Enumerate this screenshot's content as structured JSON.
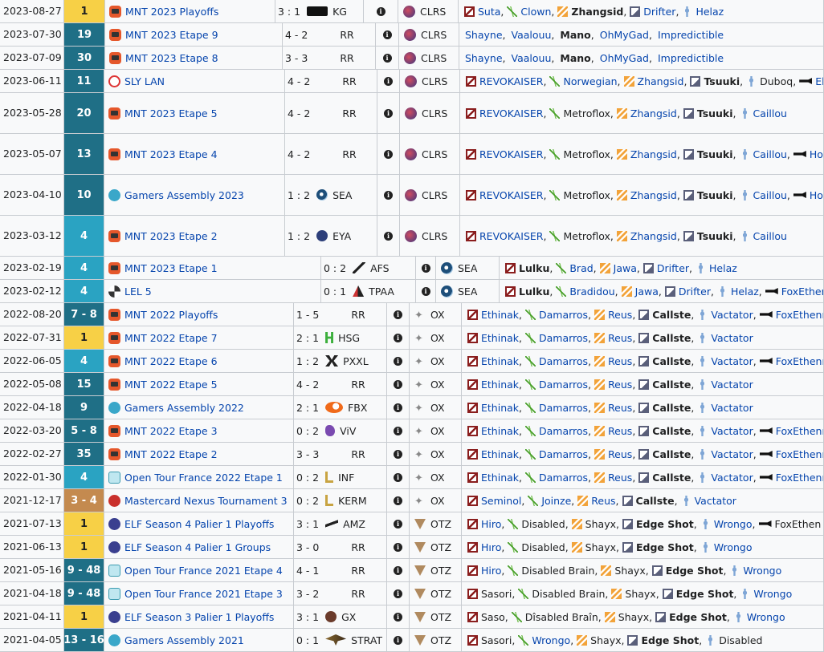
{
  "rows": [
    {
      "date": "2023-08-27",
      "place": "1",
      "pc": "#f7d046",
      "pt": "#202122",
      "tlogo": "mnt",
      "tour": "MNT 2023 Playoffs",
      "score": "3 : 1",
      "opp": "KG",
      "ologo": "kg",
      "team": "CLRS",
      "tcls": "clrs",
      "roster": [
        {
          "n": "Suta",
          "r": "top"
        },
        {
          "n": "Clown",
          "r": "jungle"
        },
        {
          "n": "Zhangsid",
          "r": "mid",
          "b": true,
          "k": true
        },
        {
          "n": "Drifter",
          "r": "bot"
        },
        {
          "n": "Helaz",
          "r": "support"
        }
      ]
    },
    {
      "date": "2023-07-30",
      "place": "19",
      "pc": "#1f6f86",
      "pt": "#fff",
      "tlogo": "mnt",
      "tour": "MNT 2023 Etape 9",
      "score": "4 - 2",
      "opp": "RR",
      "ologo": "",
      "team": "CLRS",
      "tcls": "clrs",
      "plain": true,
      "roster": [
        {
          "n": "Shayne"
        },
        {
          "n": "Vaalouu"
        },
        {
          "n": "Mano",
          "b": true,
          "k": true
        },
        {
          "n": "OhMyGad"
        },
        {
          "n": "Impredictible"
        }
      ]
    },
    {
      "date": "2023-07-09",
      "place": "30",
      "pc": "#1f6f86",
      "pt": "#fff",
      "tlogo": "mnt",
      "tour": "MNT 2023 Etape 8",
      "score": "3 - 3",
      "opp": "RR",
      "ologo": "",
      "team": "CLRS",
      "tcls": "clrs",
      "plain": true,
      "roster": [
        {
          "n": "Shayne"
        },
        {
          "n": "Vaalouu"
        },
        {
          "n": "Mano",
          "b": true,
          "k": true
        },
        {
          "n": "OhMyGad"
        },
        {
          "n": "Impredictible"
        }
      ]
    },
    {
      "date": "2023-06-11",
      "place": "11",
      "pc": "#1f6f86",
      "pt": "#fff",
      "tlogo": "sly",
      "tour": "SLY LAN",
      "score": "4 - 2",
      "opp": "RR",
      "ologo": "",
      "team": "CLRS",
      "tcls": "clrs",
      "roster": [
        {
          "n": "REVOKAISER",
          "r": "top"
        },
        {
          "n": "Norwegian",
          "r": "jungle"
        },
        {
          "n": "Zhangsid",
          "r": "mid"
        },
        {
          "n": "Tsuuki",
          "r": "bot",
          "b": true,
          "k": true
        },
        {
          "n": "Duboq",
          "r": "support",
          "k": true
        },
        {
          "n": "Ekaos",
          "r": "coach"
        }
      ]
    },
    {
      "date": "2023-05-28",
      "place": "20",
      "pc": "#1f6f86",
      "pt": "#fff",
      "tlogo": "mnt",
      "tour": "MNT 2023 Etape 5",
      "score": "4 - 2",
      "opp": "RR",
      "ologo": "",
      "team": "CLRS",
      "tcls": "clrs",
      "roster": [
        {
          "n": "REVOKAISER",
          "r": "top"
        },
        {
          "n": "Metroflox",
          "r": "jungle",
          "k": true
        },
        {
          "n": "Zhangsid",
          "r": "mid"
        },
        {
          "n": "Tsuuki",
          "r": "bot",
          "b": true,
          "k": true
        },
        {
          "n": "Caillou",
          "r": "support"
        }
      ]
    },
    {
      "date": "2023-05-07",
      "place": "13",
      "pc": "#1f6f86",
      "pt": "#fff",
      "tlogo": "mnt",
      "tour": "MNT 2023 Etape 4",
      "score": "4 - 2",
      "opp": "RR",
      "ologo": "",
      "team": "CLRS",
      "tcls": "clrs",
      "roster": [
        {
          "n": "REVOKAISER",
          "r": "top"
        },
        {
          "n": "Metroflox",
          "r": "jungle",
          "k": true
        },
        {
          "n": "Zhangsid",
          "r": "mid"
        },
        {
          "n": "Tsuuki",
          "r": "bot",
          "b": true,
          "k": true
        },
        {
          "n": "Caillou",
          "r": "support"
        },
        {
          "n": "Horéüs",
          "r": "coach"
        }
      ]
    },
    {
      "date": "2023-04-10",
      "place": "10",
      "pc": "#1f6f86",
      "pt": "#fff",
      "tlogo": "ga",
      "tour": "Gamers Assembly 2023",
      "score": "1 : 2",
      "opp": "SEA",
      "ologo": "sea",
      "team": "CLRS",
      "tcls": "clrs",
      "roster": [
        {
          "n": "REVOKAISER",
          "r": "top"
        },
        {
          "n": "Metroflox",
          "r": "jungle",
          "k": true
        },
        {
          "n": "Zhangsid",
          "r": "mid"
        },
        {
          "n": "Tsuuki",
          "r": "bot",
          "b": true,
          "k": true
        },
        {
          "n": "Caillou",
          "r": "support"
        },
        {
          "n": "Horéüs",
          "r": "coach"
        }
      ]
    },
    {
      "date": "2023-03-12",
      "place": "4",
      "pc": "#2aa3c2",
      "pt": "#fff",
      "tlogo": "mnt",
      "tour": "MNT 2023 Etape 2",
      "score": "1 : 2",
      "opp": "EYA",
      "ologo": "eya",
      "team": "CLRS",
      "tcls": "clrs",
      "roster": [
        {
          "n": "REVOKAISER",
          "r": "top"
        },
        {
          "n": "Metroflox",
          "r": "jungle",
          "k": true
        },
        {
          "n": "Zhangsid",
          "r": "mid"
        },
        {
          "n": "Tsuuki",
          "r": "bot",
          "b": true,
          "k": true
        },
        {
          "n": "Caillou",
          "r": "support"
        }
      ]
    },
    {
      "date": "2023-02-19",
      "place": "4",
      "pc": "#2aa3c2",
      "pt": "#fff",
      "tlogo": "mnt",
      "tour": "MNT 2023 Etape 1",
      "score": "0 : 2",
      "opp": "AFS",
      "ologo": "afs",
      "team": "SEA",
      "tcls": "sea",
      "roster": [
        {
          "n": "Lulku",
          "r": "top",
          "b": true,
          "k": true
        },
        {
          "n": "Brad",
          "r": "jungle"
        },
        {
          "n": "Jawa",
          "r": "mid"
        },
        {
          "n": "Drifter",
          "r": "bot"
        },
        {
          "n": "Helaz",
          "r": "support"
        }
      ]
    },
    {
      "date": "2023-02-12",
      "place": "4",
      "pc": "#2aa3c2",
      "pt": "#fff",
      "tlogo": "lel",
      "tour": "LEL 5",
      "score": "0 : 1",
      "opp": "TPAA",
      "ologo": "tpaa",
      "team": "SEA",
      "tcls": "sea",
      "roster": [
        {
          "n": "Lulku",
          "r": "top",
          "b": true,
          "k": true
        },
        {
          "n": "Bradidou",
          "r": "jungle"
        },
        {
          "n": "Jawa",
          "r": "mid"
        },
        {
          "n": "Drifter",
          "r": "bot"
        },
        {
          "n": "Helaz",
          "r": "support"
        },
        {
          "n": "FoxEthenn",
          "r": "coach"
        }
      ]
    },
    {
      "date": "2022-08-20",
      "place": "7 - 8",
      "pc": "#1f6f86",
      "pt": "#fff",
      "tlogo": "mnt",
      "tour": "MNT 2022 Playoffs",
      "score": "1 - 5",
      "opp": "RR",
      "ologo": "",
      "team": "OX",
      "tcls": "ox",
      "roster": [
        {
          "n": "Ethinak",
          "r": "top"
        },
        {
          "n": "Damarros",
          "r": "jungle"
        },
        {
          "n": "Reus",
          "r": "mid"
        },
        {
          "n": "Callste",
          "r": "bot",
          "b": true,
          "k": true
        },
        {
          "n": "Vactator",
          "r": "support"
        },
        {
          "n": "FoxEthenn",
          "r": "coach"
        }
      ]
    },
    {
      "date": "2022-07-31",
      "place": "1",
      "pc": "#f7d046",
      "pt": "#202122",
      "tlogo": "mnt",
      "tour": "MNT 2022 Etape 7",
      "score": "2 : 1",
      "opp": "HSG",
      "ologo": "hsg",
      "team": "OX",
      "tcls": "ox",
      "roster": [
        {
          "n": "Ethinak",
          "r": "top"
        },
        {
          "n": "Damarros",
          "r": "jungle"
        },
        {
          "n": "Reus",
          "r": "mid"
        },
        {
          "n": "Callste",
          "r": "bot",
          "b": true,
          "k": true
        },
        {
          "n": "Vactator",
          "r": "support"
        }
      ]
    },
    {
      "date": "2022-06-05",
      "place": "4",
      "pc": "#2aa3c2",
      "pt": "#fff",
      "tlogo": "mnt",
      "tour": "MNT 2022 Etape 6",
      "score": "1 : 2",
      "opp": "PXXL",
      "ologo": "pxxl",
      "team": "OX",
      "tcls": "ox",
      "roster": [
        {
          "n": "Ethinak",
          "r": "top"
        },
        {
          "n": "Damarros",
          "r": "jungle"
        },
        {
          "n": "Reus",
          "r": "mid"
        },
        {
          "n": "Callste",
          "r": "bot",
          "b": true,
          "k": true
        },
        {
          "n": "Vactator",
          "r": "support"
        },
        {
          "n": "FoxEthenn",
          "r": "coach"
        }
      ]
    },
    {
      "date": "2022-05-08",
      "place": "15",
      "pc": "#1f6f86",
      "pt": "#fff",
      "tlogo": "mnt",
      "tour": "MNT 2022 Etape 5",
      "score": "4 - 2",
      "opp": "RR",
      "ologo": "",
      "team": "OX",
      "tcls": "ox",
      "roster": [
        {
          "n": "Ethinak",
          "r": "top"
        },
        {
          "n": "Damarros",
          "r": "jungle"
        },
        {
          "n": "Reus",
          "r": "mid"
        },
        {
          "n": "Callste",
          "r": "bot",
          "b": true,
          "k": true
        },
        {
          "n": "Vactator",
          "r": "support"
        }
      ]
    },
    {
      "date": "2022-04-18",
      "place": "9",
      "pc": "#1f6f86",
      "pt": "#fff",
      "tlogo": "ga",
      "tour": "Gamers Assembly 2022",
      "score": "2 : 1",
      "opp": "FBX",
      "ologo": "fbx",
      "team": "OX",
      "tcls": "ox",
      "roster": [
        {
          "n": "Ethinak",
          "r": "top"
        },
        {
          "n": "Damarros",
          "r": "jungle"
        },
        {
          "n": "Reus",
          "r": "mid"
        },
        {
          "n": "Callste",
          "r": "bot",
          "b": true,
          "k": true
        },
        {
          "n": "Vactator",
          "r": "support"
        }
      ]
    },
    {
      "date": "2022-03-20",
      "place": "5 - 8",
      "pc": "#1f6f86",
      "pt": "#fff",
      "tlogo": "mnt",
      "tour": "MNT 2022 Etape 3",
      "score": "0 : 2",
      "opp": "ViV",
      "ologo": "viv",
      "team": "OX",
      "tcls": "ox",
      "roster": [
        {
          "n": "Ethinak",
          "r": "top"
        },
        {
          "n": "Damarros",
          "r": "jungle"
        },
        {
          "n": "Reus",
          "r": "mid"
        },
        {
          "n": "Callste",
          "r": "bot",
          "b": true,
          "k": true
        },
        {
          "n": "Vactator",
          "r": "support"
        },
        {
          "n": "FoxEthenn",
          "r": "coach"
        }
      ]
    },
    {
      "date": "2022-02-27",
      "place": "35",
      "pc": "#1f6f86",
      "pt": "#fff",
      "tlogo": "mnt",
      "tour": "MNT 2022 Etape 2",
      "score": "3 - 3",
      "opp": "RR",
      "ologo": "",
      "team": "OX",
      "tcls": "ox",
      "roster": [
        {
          "n": "Ethinak",
          "r": "top"
        },
        {
          "n": "Damarros",
          "r": "jungle"
        },
        {
          "n": "Reus",
          "r": "mid"
        },
        {
          "n": "Callste",
          "r": "bot",
          "b": true,
          "k": true
        },
        {
          "n": "Vactator",
          "r": "support"
        },
        {
          "n": "FoxEthenn",
          "r": "coach"
        }
      ]
    },
    {
      "date": "2022-01-30",
      "place": "4",
      "pc": "#2aa3c2",
      "pt": "#fff",
      "tlogo": "otf",
      "tour": "Open Tour France 2022 Etape 1",
      "score": "0 : 2",
      "opp": "INF",
      "ologo": "inf",
      "team": "OX",
      "tcls": "ox",
      "roster": [
        {
          "n": "Ethinak",
          "r": "top"
        },
        {
          "n": "Damarros",
          "r": "jungle"
        },
        {
          "n": "Reus",
          "r": "mid"
        },
        {
          "n": "Callste",
          "r": "bot",
          "b": true,
          "k": true
        },
        {
          "n": "Vactator",
          "r": "support"
        },
        {
          "n": "FoxEthenn",
          "r": "coach"
        }
      ]
    },
    {
      "date": "2021-12-17",
      "place": "3 - 4",
      "pc": "#c48a4f",
      "pt": "#fff",
      "tlogo": "mc",
      "tour": "Mastercard Nexus Tournament 3",
      "score": "0 : 2",
      "opp": "KERM",
      "ologo": "inf",
      "team": "OX",
      "tcls": "ox",
      "roster": [
        {
          "n": "Seminol",
          "r": "top"
        },
        {
          "n": "Joinze",
          "r": "jungle"
        },
        {
          "n": "Reus",
          "r": "mid"
        },
        {
          "n": "Callste",
          "r": "bot",
          "b": true,
          "k": true
        },
        {
          "n": "Vactator",
          "r": "support"
        }
      ]
    },
    {
      "date": "2021-07-13",
      "place": "1",
      "pc": "#f7d046",
      "pt": "#202122",
      "tlogo": "elf",
      "tour": "ELF Season 4 Palier 1 Playoffs",
      "score": "3 : 1",
      "opp": "AMZ",
      "ologo": "amz",
      "team": "OTZ",
      "tcls": "otz",
      "roster": [
        {
          "n": "Hiro",
          "r": "top"
        },
        {
          "n": "Disabled",
          "r": "jungle",
          "k": true
        },
        {
          "n": "Shayx",
          "r": "mid",
          "k": true
        },
        {
          "n": "Edge Shot",
          "r": "bot",
          "b": true,
          "k": true
        },
        {
          "n": "Wrongo",
          "r": "support"
        },
        {
          "n": "FoxEthen",
          "r": "coach",
          "k": true
        }
      ]
    },
    {
      "date": "2021-06-13",
      "place": "1",
      "pc": "#f7d046",
      "pt": "#202122",
      "tlogo": "elf",
      "tour": "ELF Season 4 Palier 1 Groups",
      "score": "3 - 0",
      "opp": "RR",
      "ologo": "",
      "team": "OTZ",
      "tcls": "otz",
      "roster": [
        {
          "n": "Hıro",
          "r": "top"
        },
        {
          "n": "Disabled",
          "r": "jungle",
          "k": true
        },
        {
          "n": "Shayx",
          "r": "mid",
          "k": true
        },
        {
          "n": "Edge Shot",
          "r": "bot",
          "b": true,
          "k": true
        },
        {
          "n": "Wrongo",
          "r": "support"
        }
      ]
    },
    {
      "date": "2021-05-16",
      "place": "9 - 48",
      "pc": "#1f6f86",
      "pt": "#fff",
      "tlogo": "otf",
      "tour": "Open Tour France 2021 Etape 4",
      "score": "4 - 1",
      "opp": "RR",
      "ologo": "",
      "team": "OTZ",
      "tcls": "otz",
      "roster": [
        {
          "n": "Hiro",
          "r": "top"
        },
        {
          "n": "Disabled Brain",
          "r": "jungle",
          "k": true
        },
        {
          "n": "Shayx",
          "r": "mid",
          "k": true
        },
        {
          "n": "Edge Shot",
          "r": "bot",
          "b": true,
          "k": true
        },
        {
          "n": "Wrongo",
          "r": "support"
        }
      ]
    },
    {
      "date": "2021-04-18",
      "place": "9 - 48",
      "pc": "#1f6f86",
      "pt": "#fff",
      "tlogo": "otf",
      "tour": "Open Tour France 2021 Etape 3",
      "score": "3 - 2",
      "opp": "RR",
      "ologo": "",
      "team": "OTZ",
      "tcls": "otz",
      "roster": [
        {
          "n": "Sasori",
          "r": "top",
          "k": true
        },
        {
          "n": "Disabled Brain",
          "r": "jungle",
          "k": true
        },
        {
          "n": "Shayx",
          "r": "mid",
          "k": true
        },
        {
          "n": "Edge Shot",
          "r": "bot",
          "b": true,
          "k": true
        },
        {
          "n": "Wrongo",
          "r": "support"
        }
      ]
    },
    {
      "date": "2021-04-11",
      "place": "1",
      "pc": "#f7d046",
      "pt": "#202122",
      "tlogo": "elf",
      "tour": "ELF Season 3 Palier 1 Playoffs",
      "score": "3 : 1",
      "opp": "GX",
      "ologo": "gx",
      "team": "OTZ",
      "tcls": "otz",
      "roster": [
        {
          "n": "Saso",
          "r": "top",
          "k": true
        },
        {
          "n": "Dîsabled Braîn",
          "r": "jungle",
          "k": true
        },
        {
          "n": "Shayx",
          "r": "mid",
          "k": true
        },
        {
          "n": "Edge Shot",
          "r": "bot",
          "b": true,
          "k": true
        },
        {
          "n": "Wrongo",
          "r": "support"
        }
      ]
    },
    {
      "date": "2021-04-05",
      "place": "13 - 16",
      "pc": "#1f6f86",
      "pt": "#fff",
      "tlogo": "ga",
      "tour": "Gamers Assembly 2021",
      "score": "0 : 1",
      "opp": "STRAT",
      "ologo": "strat",
      "team": "OTZ",
      "tcls": "otz",
      "roster": [
        {
          "n": "Sasori",
          "r": "top",
          "k": true
        },
        {
          "n": "Wrongo",
          "r": "jungle"
        },
        {
          "n": "Shayx",
          "r": "mid",
          "k": true
        },
        {
          "n": "Edge Shot",
          "r": "bot",
          "b": true,
          "k": true
        },
        {
          "n": "Disabled",
          "r": "support",
          "k": true
        }
      ]
    }
  ]
}
